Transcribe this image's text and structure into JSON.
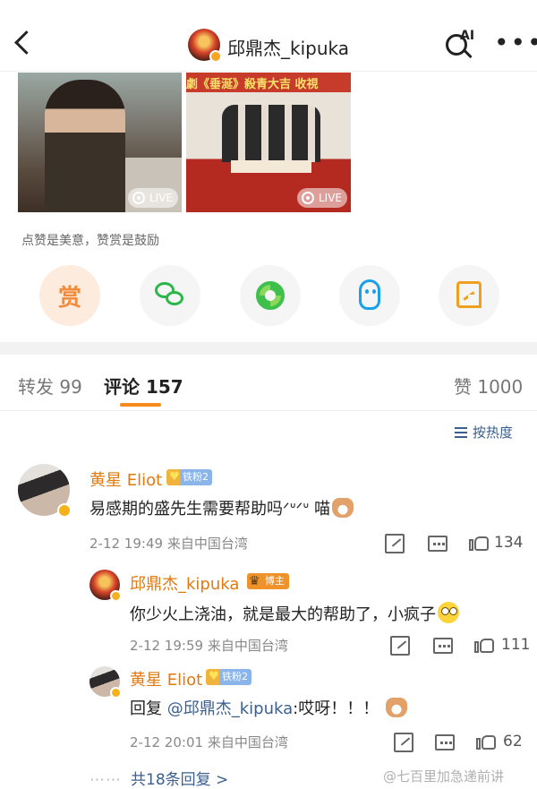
{
  "header": {
    "title": "邱鼎杰_kipuka",
    "ai_label": "AI",
    "more_label": "•••"
  },
  "media": {
    "photo2_banner": "劇《垂涎》殺青大吉 收視",
    "live_label": "LIVE"
  },
  "reward_hint": "点赞是美意，赞赏是鼓励",
  "share": {
    "reward_char": "赏",
    "items": [
      "reward-icon",
      "wechat-icon",
      "moments-icon",
      "qq-icon",
      "save-image-icon"
    ]
  },
  "tabs": {
    "repost": "转发 99",
    "comments": "评论 157",
    "likes": "赞 1000"
  },
  "sort_label": "按热度",
  "comments": [
    {
      "username": "黄星 Eliot",
      "badge": "铁粉2",
      "text": "易感期的盛先生需要帮助吗",
      "text_suffix": "ᐟᐡᐟᐡ 喵",
      "time": "2-12 19:49",
      "location": "来自中国台湾",
      "likes": "134"
    }
  ],
  "replies": [
    {
      "username": "邱鼎杰_kipuka",
      "badge": "博主",
      "text": "你少火上浇油，就是最大的帮助了，小疯子",
      "time": "2-12 19:59",
      "location": "来自中国台湾",
      "likes": "111"
    },
    {
      "username": "黄星 Eliot",
      "badge": "铁粉2",
      "text_prefix": "回复 ",
      "mention": "@邱鼎杰_kipuka",
      "text": ":哎呀！！！",
      "time": "2-12 20:01",
      "location": "来自中国台湾",
      "likes": "62"
    }
  ],
  "more_replies": "共18条回复 >",
  "watermark": "@七百里加急递前讲",
  "colors": {
    "username": "#e07a12",
    "link": "#3a5f8f",
    "tab_accent": "#f58a1a"
  }
}
